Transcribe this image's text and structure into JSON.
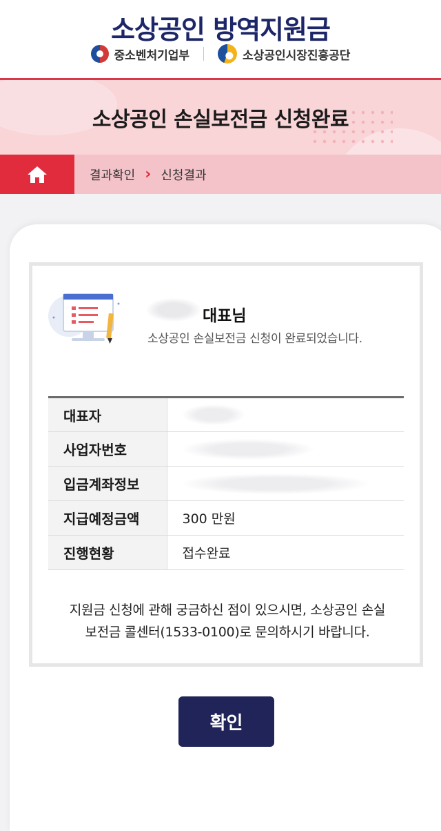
{
  "header": {
    "site_title": "소상공인 방역지원금",
    "org_left": "중소벤처기업부",
    "org_right": "소상공인시장진흥공단"
  },
  "banner": {
    "page_title": "소상공인 손실보전금 신청완료"
  },
  "breadcrumb": {
    "home_icon": "home-icon",
    "items": [
      "결과확인",
      "신청결과"
    ],
    "separator": "›"
  },
  "result": {
    "greeting_suffix": "대표님",
    "message": "소상공인 손실보전금 신청이 완료되었습니다.",
    "rows": [
      {
        "label": "대표자",
        "value": ""
      },
      {
        "label": "사업자번호",
        "value": ""
      },
      {
        "label": "입금계좌정보",
        "value": ""
      },
      {
        "label": "지급예정금액",
        "value": "300 만원"
      },
      {
        "label": "진행현황",
        "value": "접수완료"
      }
    ],
    "notice_line1": "지원금 신청에 관해 궁금하신 점이 있으시면, 소상공인 손실",
    "notice_line2": "보전금 콜센터(1533-0100)로 문의하시기 바랍니다."
  },
  "actions": {
    "confirm_label": "확인"
  },
  "colors": {
    "navy": "#1d2668",
    "accent_red": "#e02c3c",
    "button": "#212458"
  }
}
